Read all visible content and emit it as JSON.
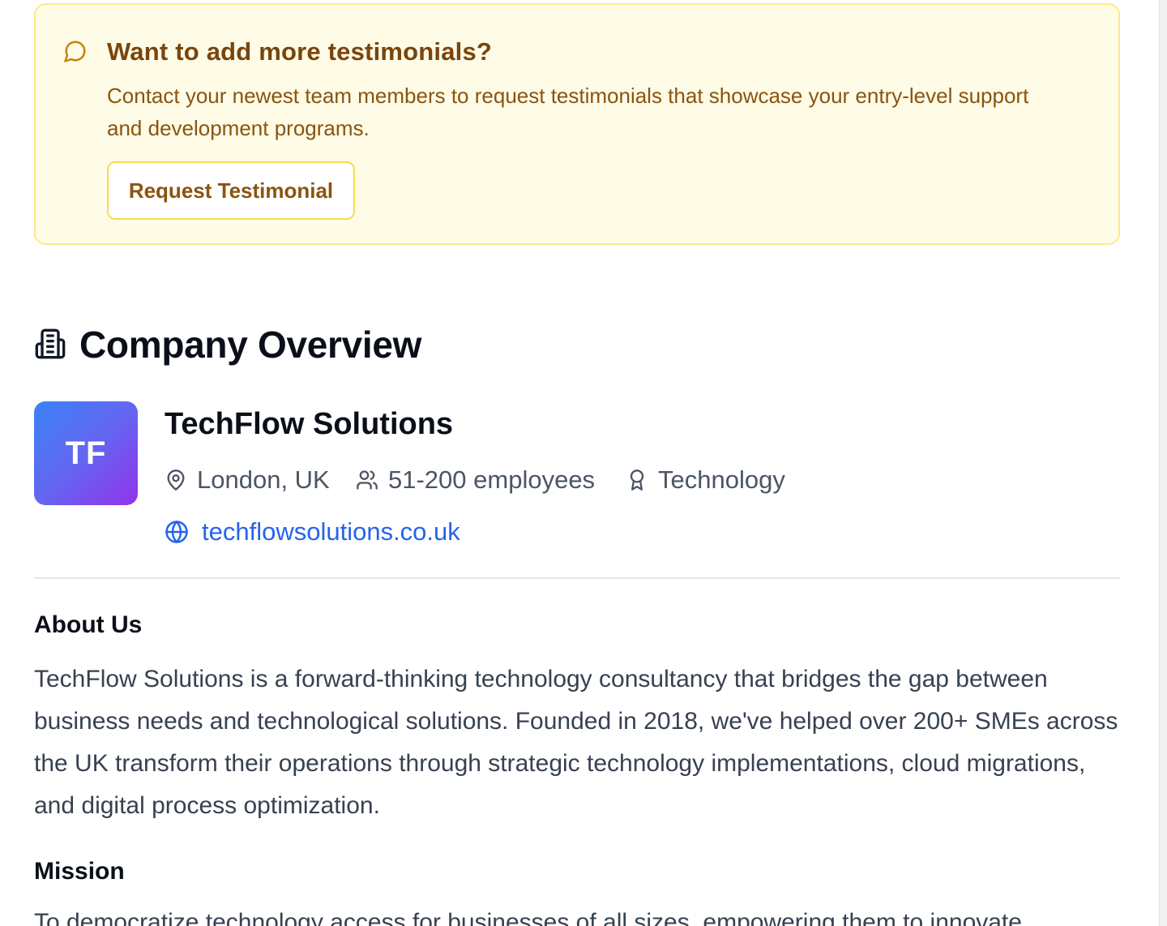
{
  "testimonial_callout": {
    "title": "Want to add more testimonials?",
    "text": "Contact your newest team members to request testimonials that showcase your entry-level support and development programs.",
    "button_label": "Request Testimonial",
    "icon": "message-circle-icon",
    "colors": {
      "background": "#fefbe6",
      "border": "#fbe98a",
      "title": "#78450d",
      "text": "#8a5410"
    }
  },
  "section": {
    "title": "Company Overview",
    "icon": "building-icon"
  },
  "company": {
    "logo_initials": "TF",
    "name": "TechFlow Solutions",
    "location": "London, UK",
    "size": "51-200 employees",
    "industry": "Technology",
    "website": "techflowsolutions.co.uk",
    "logo_gradient": [
      "#3b82f6",
      "#9333ea"
    ],
    "link_color": "#2563eb"
  },
  "about": {
    "heading": "About Us",
    "text": "TechFlow Solutions is a forward-thinking technology consultancy that bridges the gap between business needs and technological solutions. Founded in 2018, we've helped over 200+ SMEs across the UK transform their operations through strategic technology implementations, cloud migrations, and digital process optimization."
  },
  "mission": {
    "heading": "Mission",
    "text": "To democratize technology access for businesses of all sizes, empowering them to innovate"
  }
}
